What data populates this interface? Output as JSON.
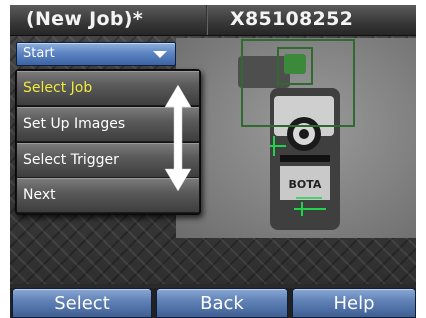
{
  "header": {
    "title": "(New Job)*",
    "device_id": "X85108252"
  },
  "dropdown": {
    "label": "Start",
    "icon": "chevron-down-icon"
  },
  "menu": {
    "items": [
      {
        "label": "Select Job",
        "selected": true
      },
      {
        "label": "Set Up Images",
        "selected": false
      },
      {
        "label": "Select Trigger",
        "selected": false
      },
      {
        "label": "Next",
        "selected": false
      }
    ],
    "scroll_icon": "up-down-arrow-icon"
  },
  "camera_view": {
    "part_label": "BOTA",
    "roi_color": "#2f6b2f",
    "marker_color": "#21d34a"
  },
  "softkeys": {
    "select": "Select",
    "back": "Back",
    "help": "Help"
  },
  "colors": {
    "accent_blue": "#5d85c2",
    "highlight_text": "#f2ea3a"
  }
}
